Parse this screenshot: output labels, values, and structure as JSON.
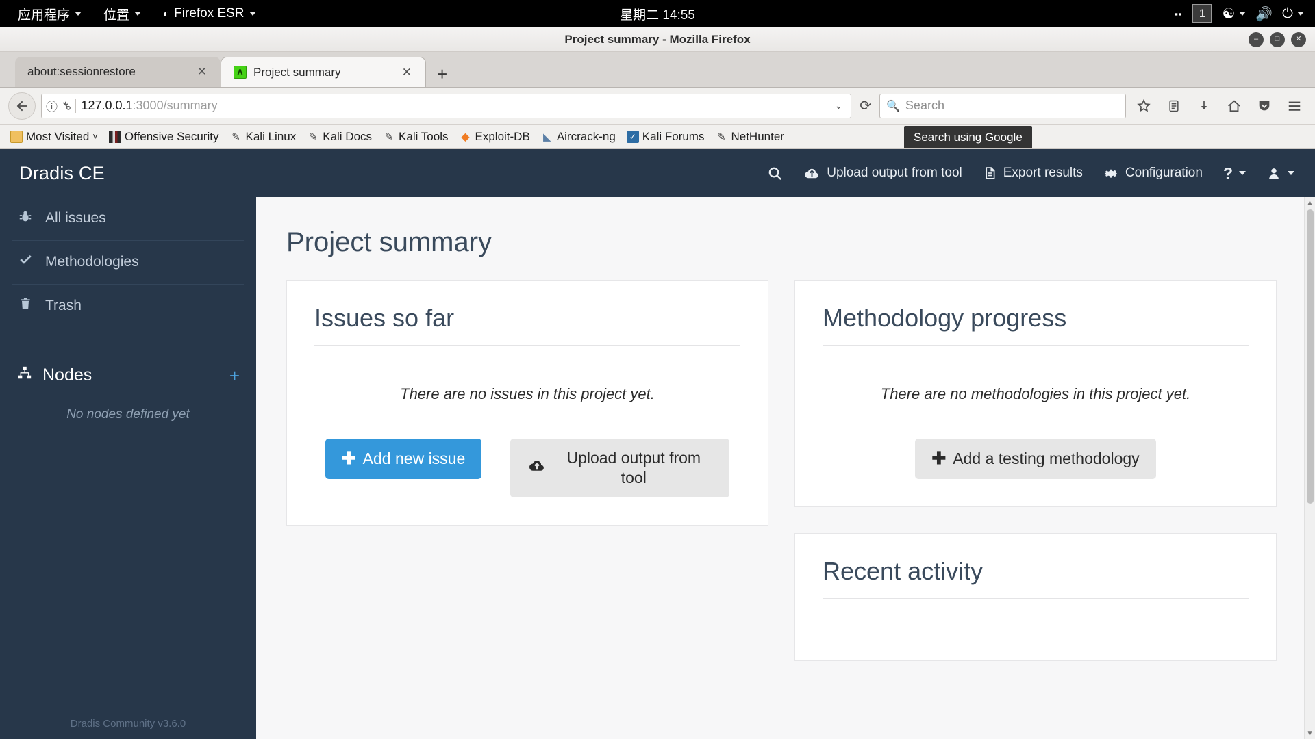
{
  "desktop": {
    "menus": [
      {
        "label": "应用程序",
        "icon": ""
      },
      {
        "label": "位置",
        "icon": ""
      },
      {
        "label": "Firefox ESR",
        "icon": "firefox-icon"
      }
    ],
    "clock": "星期二 14:55",
    "tray": {
      "workspace": "1",
      "icons": [
        "workspace-switcher-icon",
        "accessibility-icon",
        "volume-icon",
        "power-icon"
      ]
    }
  },
  "browser": {
    "window_title": "Project summary - Mozilla Firefox",
    "window_buttons": {
      "minimize": "–",
      "maximize": "□",
      "close": "✕"
    },
    "tabs": [
      {
        "title": "about:sessionrestore",
        "close": "✕",
        "active": false
      },
      {
        "title": "Project summary",
        "close": "✕",
        "active": true,
        "favicon": "Λ"
      }
    ],
    "new_tab": "+",
    "url": {
      "prefix": "127.0.0.1",
      "suffix": ":3000/summary"
    },
    "search": {
      "placeholder": "Search"
    },
    "tooltip": "Search using Google",
    "bookmarks": [
      {
        "label": "Most Visited",
        "icon": "folder-icon",
        "caret": "˅"
      },
      {
        "label": "Offensive Security",
        "icon": "offensive-security-icon"
      },
      {
        "label": "Kali Linux",
        "icon": "kali-dragon-icon"
      },
      {
        "label": "Kali Docs",
        "icon": "kali-dragon-icon"
      },
      {
        "label": "Kali Tools",
        "icon": "kali-dragon-icon"
      },
      {
        "label": "Exploit-DB",
        "icon": "exploit-db-icon"
      },
      {
        "label": "Aircrack-ng",
        "icon": "aircrack-ng-icon"
      },
      {
        "label": "Kali Forums",
        "icon": "kali-forums-icon"
      },
      {
        "label": "NetHunter",
        "icon": "kali-dragon-icon"
      }
    ],
    "toolbar_icons": [
      "bookmark-star-icon",
      "library-icon",
      "downloads-icon",
      "home-icon",
      "pocket-icon",
      "menu-icon"
    ]
  },
  "app": {
    "brand": "Dradis CE",
    "nav": [
      {
        "label": "",
        "icon": "search-icon",
        "name": "nav-search"
      },
      {
        "label": "Upload output from tool",
        "icon": "cloud-upload-icon",
        "name": "nav-upload"
      },
      {
        "label": "Export results",
        "icon": "document-icon",
        "name": "nav-export"
      },
      {
        "label": "Configuration",
        "icon": "gear-icon",
        "name": "nav-configuration"
      },
      {
        "label": "?",
        "icon": "help-icon",
        "name": "nav-help",
        "caret": true
      },
      {
        "label": "",
        "icon": "user-icon",
        "name": "nav-user",
        "caret": true
      }
    ],
    "sidebar": {
      "items": [
        {
          "label": "All issues",
          "icon": "bug-icon"
        },
        {
          "label": "Methodologies",
          "icon": "check-icon"
        },
        {
          "label": "Trash",
          "icon": "trash-icon"
        }
      ],
      "nodes": {
        "label": "Nodes",
        "icon": "sitemap-icon",
        "add": "+",
        "empty": "No nodes defined yet"
      },
      "footer": "Dradis Community v3.6.0"
    },
    "page_title": "Project summary",
    "cards": {
      "issues": {
        "title": "Issues so far",
        "empty": "There are no issues in this project yet.",
        "primary_button": "Add new issue",
        "secondary_button": "Upload output from tool"
      },
      "methodology": {
        "title": "Methodology progress",
        "empty": "There are no methodologies in this project yet.",
        "button": "Add a testing methodology"
      },
      "recent": {
        "title": "Recent activity"
      }
    }
  },
  "colors": {
    "app_navy": "#27374a",
    "primary_blue": "#3498db",
    "heading": "#3a4a5c",
    "sidebar_text": "#c3cedb"
  }
}
